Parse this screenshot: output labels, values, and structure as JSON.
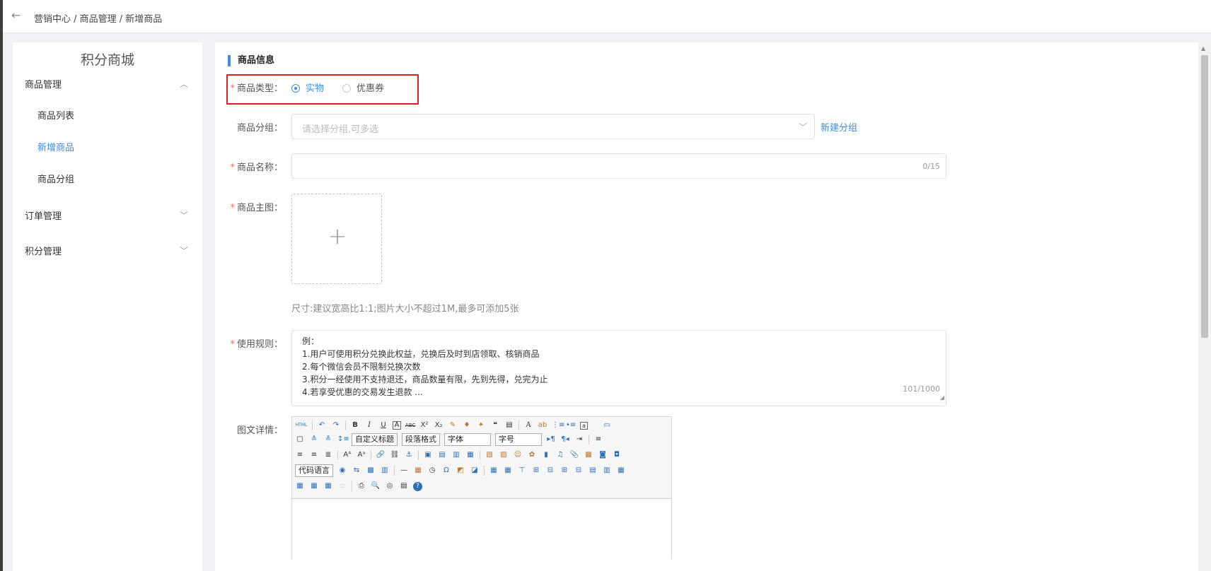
{
  "breadcrumb": "营销中心 / 商品管理 / 新增商品",
  "sidebar": {
    "title": "积分商城",
    "group1": "商品管理",
    "items": [
      "商品列表",
      "新增商品",
      "商品分组"
    ],
    "group2": "订单管理",
    "group3": "积分管理"
  },
  "form": {
    "section_title": "商品信息",
    "type_label": "商品类型：",
    "type_options": [
      "实物",
      "优惠券"
    ],
    "type_selected": "实物",
    "group_label": "商品分组：",
    "group_placeholder": "请选择分组,可多选",
    "new_group_link": "新建分组",
    "name_label": "商品名称：",
    "name_count": "0/15",
    "image_label": "商品主图：",
    "image_hint": "尺寸:建议宽高比1:1;图片大小不超过1M,最多可添加5张",
    "rules_label": "使用规则：",
    "rules_lines": [
      "例：",
      "1.用户可使用积分兑换此权益，兑换后及时到店领取、核销商品",
      "2.每个微信会员不限制兑换次数",
      "3.积分一经使用不支持退还，商品数量有限，先到先得，兑完为止",
      "4.若享受优惠的交易发生退款 ..."
    ],
    "rules_count": "101/1000",
    "detail_label": "图文详情："
  },
  "editor": {
    "custom_title": "自定义标题",
    "paragraph_format": "段落格式",
    "font": "字体",
    "font_size": "字号",
    "code_lang": "代码语言",
    "html_btn": "HTML"
  }
}
